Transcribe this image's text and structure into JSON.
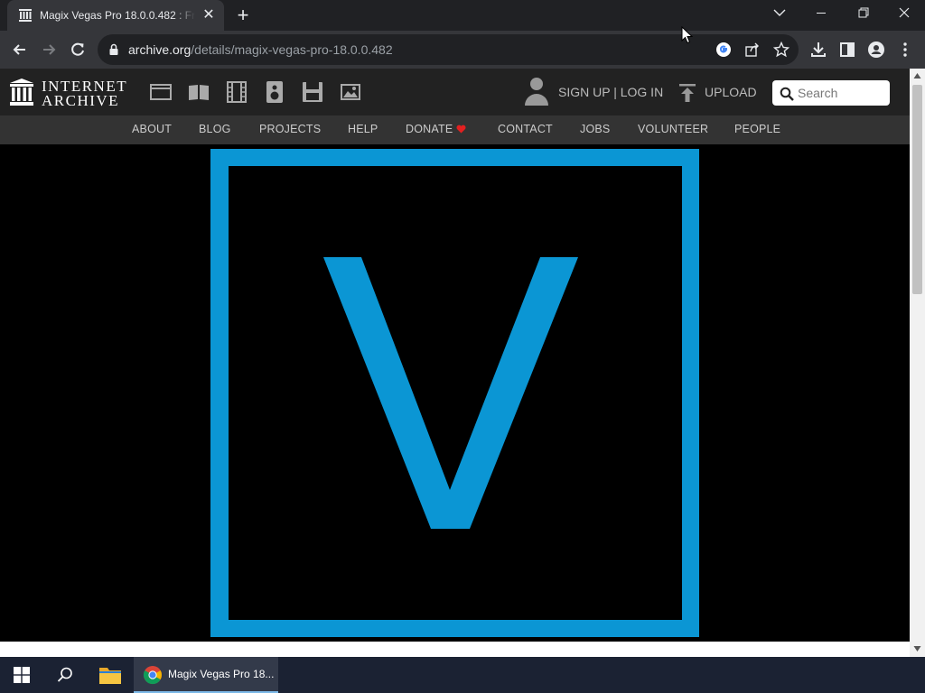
{
  "browser": {
    "tab_title": "Magix Vegas Pro 18.0.0.482 : Free",
    "tab_close": "✕",
    "new_tab": "+",
    "url_host": "archive.org",
    "url_path": "/details/magix-vegas-pro-18.0.0.482"
  },
  "ia": {
    "logo_line1": "INTERNET",
    "logo_line2": "ARCHIVE",
    "media_icons": [
      "web-icon",
      "texts-icon",
      "video-icon",
      "audio-icon",
      "software-icon",
      "images-icon"
    ],
    "signup_text": "SIGN UP | LOG IN",
    "upload_text": "UPLOAD",
    "search_placeholder": "Search",
    "nav": [
      "ABOUT",
      "BLOG",
      "PROJECTS",
      "HELP",
      "DONATE",
      "CONTACT",
      "JOBS",
      "VOLUNTEER",
      "PEOPLE"
    ]
  },
  "content": {
    "logo_letter": "V",
    "accent_color": "#0b96d4"
  },
  "taskbar": {
    "chrome_label": "Magix Vegas Pro 18..."
  }
}
